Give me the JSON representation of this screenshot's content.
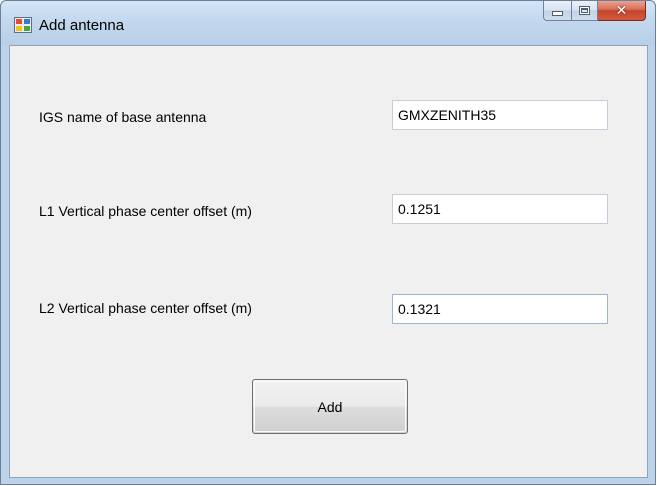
{
  "window": {
    "title": "Add antenna",
    "controls": {
      "minimize": "minimize-icon",
      "maximize": "maximize-icon",
      "close": "close-icon"
    }
  },
  "form": {
    "igs_name": {
      "label": "IGS name of base antenna",
      "value": "GMXZENITH35"
    },
    "l1_offset": {
      "label": "L1 Vertical phase center offset (m)",
      "value": "0.1251"
    },
    "l2_offset": {
      "label": "L2 Vertical phase center offset (m)",
      "value": "0.1321",
      "focused": true
    },
    "add_button_label": "Add"
  },
  "colors": {
    "title_bar": "#c3d8ee",
    "client_bg": "#f0f0f0",
    "close_button": "#c4452c"
  }
}
